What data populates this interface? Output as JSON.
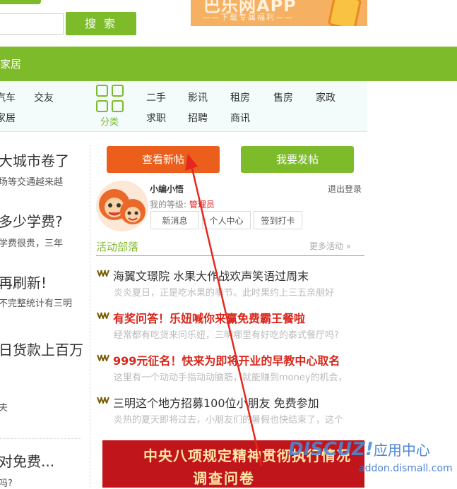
{
  "header": {
    "search_button": "搜 索",
    "banner_title": "巴乐网APP",
    "banner_subtitle": "——下载专属福利——"
  },
  "nav": {
    "current": "家居"
  },
  "categories": {
    "left_row1": [
      "汽车",
      "交友"
    ],
    "left_row2": [
      "家居"
    ],
    "label": "分类",
    "row1": [
      "二手",
      "影讯",
      "租房",
      "售房",
      "家政"
    ],
    "row2": [
      "求职",
      "招聘",
      "商讯"
    ]
  },
  "left_column": {
    "items": [
      {
        "title": "大城市卷了",
        "desc": "场等交通越来越"
      },
      {
        "title": "多少学费?",
        "desc": "学费很贵，三年"
      },
      {
        "title": "再刷新!",
        "desc": "不完整统计有三明"
      },
      {
        "title": "日货款上百万",
        "desc": ""
      },
      {
        "title": "",
        "desc": "夫"
      },
      {
        "title": "对免费...",
        "desc": "吗?"
      }
    ]
  },
  "user_panel": {
    "view_new_posts": "查看新帖",
    "post_new": "我要发帖",
    "username": "小编小悟",
    "level_label": "我的等级: ",
    "level_value": "管理员",
    "logout": "退出登录",
    "buttons": [
      "新消息",
      "个人中心",
      "签到打卡"
    ]
  },
  "activities": {
    "title": "活动部落",
    "more": "更多活动 »",
    "items": [
      {
        "title": "海翼文璟院 水果大作战欢声笑语过周末",
        "desc": "炎炎夏日，正是吃水果的季节。此时果约上三五亲朋好",
        "style": "normal"
      },
      {
        "title": "有奖问答！乐妞喊你来赢免费霸王餐啦",
        "desc": "经常都有吃货来问乐妞，三明哪里有好吃的泰式餐厅吗?",
        "style": "red"
      },
      {
        "title": "999元征名！快来为即将开业的早教中心取名",
        "desc": "这里有一个动动手指动动脑筋，就能赚到money的机会，",
        "style": "red"
      },
      {
        "title": "三明这个地方招募100位小朋友 免费参加",
        "desc": "炎热的夏天即将过去，小朋友们的暑假也快结束了，这个",
        "style": "normal"
      }
    ]
  },
  "bottom_banner": {
    "line1": "中央八项规定精神贯彻执行情况",
    "line2": "调查问卷"
  },
  "watermark": {
    "brand": "DISCUZ!",
    "cn": "应用中心",
    "url": "addon.dismall.com"
  },
  "colors": {
    "green": "#7dbb2a",
    "orange": "#ec5e1b",
    "red": "#d8261b"
  }
}
